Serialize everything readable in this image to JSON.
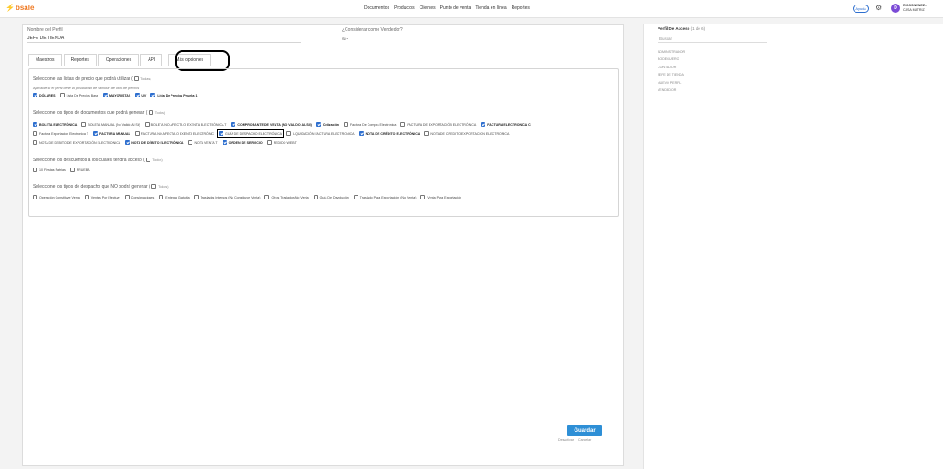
{
  "topbar": {
    "logo": "bsale",
    "nav": [
      "Documentos",
      "Productos",
      "Clientes",
      "Punto de venta",
      "Tienda en línea",
      "Reportes"
    ],
    "help_label": "Ayuda",
    "avatar_initial": "D",
    "user_name": "RIGOSNUNEZ...",
    "user_store": "CASA MATRIZ"
  },
  "profile": {
    "name_label": "Nombre del Perfil",
    "name_value": "JEFE DE TIENDA",
    "seller_label": "¿Considerar como Vendedor?",
    "seller_value": "Si ▾"
  },
  "tabs": [
    {
      "label": "Maestros"
    },
    {
      "label": "Reportes"
    },
    {
      "label": "Operaciones"
    },
    {
      "label": "API"
    },
    {
      "label": "Más opciones"
    }
  ],
  "price_lists": {
    "title": "Seleccione las listas de precio que podrá utilizar (",
    "all_label": "Todas)",
    "subtitle": "Aplicable si el perfil tiene la posibilidad de cambiar de lista de precios",
    "items": [
      {
        "label": "DÓLARES",
        "checked": true
      },
      {
        "label": "Lista De Precios Base",
        "checked": false
      },
      {
        "label": "MAYORISTAS",
        "checked": true
      },
      {
        "label": "UV",
        "checked": true
      },
      {
        "label": "Lista De Precios Prueba 1",
        "checked": true
      }
    ]
  },
  "doc_types": {
    "title": "Seleccione los tipos de documentos que podrá generar (",
    "all_label": "Todos)",
    "rows": [
      [
        {
          "label": "BOLETA ELECTRÓNICA",
          "checked": true
        },
        {
          "label": "BOLETA MANUAL (No Valido Al Sii)",
          "checked": false
        },
        {
          "label": "BOLETA NO AFECTA O EXENTA ELECTRÓNICA T",
          "checked": false
        },
        {
          "label": "COMPROBANTE DE VENTA (NO VALIDO AL SII)",
          "checked": true
        },
        {
          "label": "Cotización",
          "checked": true
        },
        {
          "label": "Factura De Compra Electrónica",
          "checked": false
        },
        {
          "label": "FACTURA DE EXPORTACIÓN ELECTRÓNICA",
          "checked": false
        },
        {
          "label": "FACTURA ELECTRONICA C",
          "checked": true
        }
      ],
      [
        {
          "label": "Factura Exportacion Electronica T",
          "checked": false
        },
        {
          "label": "FACTURA MANUAL",
          "checked": true
        },
        {
          "label": "FACTURA NO AFECTA O EXENTA ELECTRÓNIC",
          "checked": false
        },
        {
          "label": "GUÍA DE DESPACHO ELECTRÓNICA",
          "checked": true
        },
        {
          "label": "LIQUIDACIÓN FACTURA ELECTRONICA",
          "checked": false
        },
        {
          "label": "NOTA DE CRÉDITO ELECTRÓNICA",
          "checked": true
        },
        {
          "label": "NOTA DE CREDITO EXPORTACION ELECTRONICA",
          "checked": false
        }
      ],
      [
        {
          "label": "NOTA DE DEBITO DE EXPORTACIÓN ELECTRONICA",
          "checked": false
        },
        {
          "label": "NOTA DE DÉBITO ELECTRÓNICA",
          "checked": true
        },
        {
          "label": "NOTA VENTA T",
          "checked": false
        },
        {
          "label": "ORDEN DE SERVICIO",
          "checked": true
        },
        {
          "label": "PEDIDO WEB T",
          "checked": false
        }
      ]
    ]
  },
  "discounts": {
    "title": "Seleccione los descuentos a los cuales tendrá acceso (",
    "all_label": "Todos)",
    "items": [
      {
        "label": "10 Fiestas Patrias",
        "checked": false
      },
      {
        "label": "PRUEBA",
        "checked": false
      }
    ]
  },
  "dispatch": {
    "title": "Seleccione los tipos de despacho que NO podrá generar (",
    "all_label": "Todos)",
    "items": [
      {
        "label": "Operación Constituye Venta",
        "checked": false
      },
      {
        "label": "Ventas Por Efectuar",
        "checked": false
      },
      {
        "label": "Consignaciones",
        "checked": false
      },
      {
        "label": "Entrega Gratuita",
        "checked": false
      },
      {
        "label": "Traslados Internos (No Constituye Venta)",
        "checked": false
      },
      {
        "label": "Otros Traslados No Venta",
        "checked": false
      },
      {
        "label": "Guía De Devolución",
        "checked": false
      },
      {
        "label": "Traslado Para Exportación. (No Venta)",
        "checked": false
      },
      {
        "label": "Venta Para Exportación",
        "checked": false
      }
    ]
  },
  "actions": {
    "save": "Guardar",
    "deactivate": "Desactivar",
    "cancel": "Cancelar"
  },
  "side": {
    "title": "Perfil De Acceso",
    "count": "(1 de 6)",
    "search_placeholder": "Buscar",
    "profiles": [
      "ADMINISTRADOR",
      "BODEGUERO",
      "CONTADOR",
      "JEFE DE TIENDA",
      "NUEVO PERFIL",
      "VENDEDOR"
    ]
  },
  "colors": {
    "accent": "#2e6fcf",
    "brand": "#f07a23",
    "save": "#2e8fd6"
  }
}
